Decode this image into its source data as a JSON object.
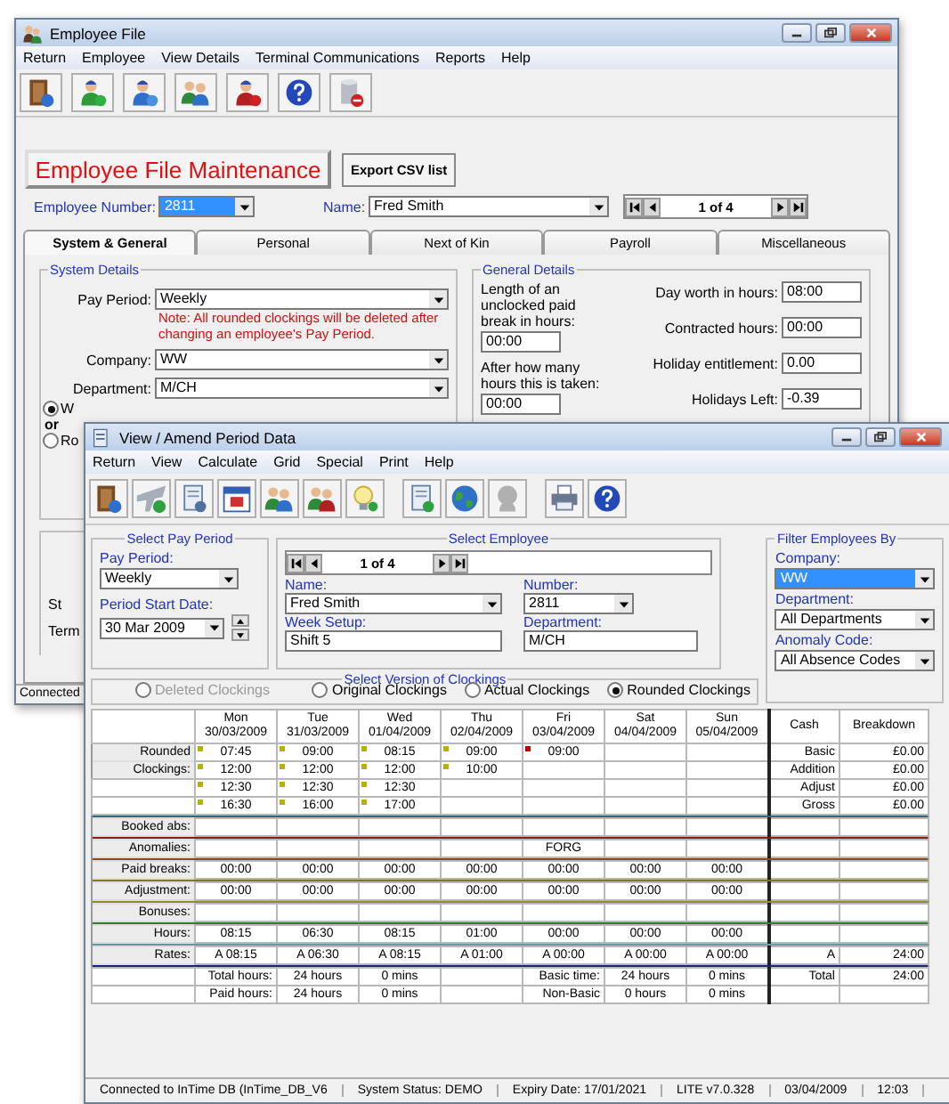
{
  "back_window": {
    "title": "Employee File",
    "menu": [
      "Return",
      "Employee",
      "View Details",
      "Terminal Communications",
      "Reports",
      "Help"
    ],
    "heading_button": "Employee File Maintenance",
    "export_button": "Export CSV list",
    "employee_number": {
      "label": "Employee Number:",
      "value": "2811",
      "highlighted": true
    },
    "name": {
      "label": "Name:",
      "value": "Fred Smith"
    },
    "navigator": "1 of 4",
    "tabs": [
      {
        "label": "System & General",
        "selected": true
      },
      {
        "label": "Personal",
        "selected": false
      },
      {
        "label": "Next of Kin",
        "selected": false
      },
      {
        "label": "Payroll",
        "selected": false
      },
      {
        "label": "Miscellaneous",
        "selected": false
      }
    ],
    "system_details": {
      "title": "System Details",
      "fields": [
        {
          "label": "Pay Period:",
          "value": "Weekly"
        },
        {
          "label": "Company:",
          "value": "WW"
        },
        {
          "label": "Department:",
          "value": "M/CH"
        }
      ],
      "note": "Note: All rounded clockings will be deleted after changing an employee's Pay Period.",
      "radios": [
        {
          "label": "W",
          "selected": true
        },
        {
          "label": "Ro",
          "selected": false
        }
      ],
      "or": "or"
    },
    "general_details": {
      "title": "General Details",
      "break_length": {
        "label": "Length of an unclocked paid break in hours:",
        "value": "00:00"
      },
      "break_after": {
        "label": "After how many hours this is taken:",
        "value": "00:00"
      },
      "fields": [
        {
          "label": "Day worth in hours:",
          "value": "08:00"
        },
        {
          "label": "Contracted hours:",
          "value": "00:00"
        },
        {
          "label": "Holiday entitlement:",
          "value": "0.00"
        },
        {
          "label": "Holidays Left:",
          "value": "-0.39"
        }
      ]
    },
    "cut_labels": [
      "St",
      "Term"
    ],
    "status_bar": "Connected"
  },
  "front_window": {
    "title": "View / Amend Period Data",
    "menu": [
      "Return",
      "View",
      "Calculate",
      "Grid",
      "Special",
      "Print",
      "Help"
    ],
    "pay_period_group": {
      "title": "Select Pay Period",
      "pay_period": {
        "label": "Pay Period:",
        "value": "Weekly"
      },
      "start_date": {
        "label": "Period Start Date:",
        "value": "30 Mar 2009"
      }
    },
    "employee_group": {
      "title": "Select Employee",
      "navigator": "1 of 4",
      "name": {
        "label": "Name:",
        "value": "Fred Smith"
      },
      "number": {
        "label": "Number:",
        "value": "2811"
      },
      "week_setup": {
        "label": "Week Setup:",
        "value": "Shift 5"
      },
      "department": {
        "label": "Department:",
        "value": "M/CH"
      }
    },
    "filter_group": {
      "title": "Filter Employees By",
      "fields": [
        {
          "label": "Company:",
          "value": "WW",
          "highlighted": true
        },
        {
          "label": "Department:",
          "value": "All Departments",
          "highlighted": false
        },
        {
          "label": "Anomaly Code:",
          "value": "All Absence Codes",
          "highlighted": false
        }
      ]
    },
    "version_group": {
      "title": "Select Version of Clockings",
      "options": [
        {
          "label": "Deleted Clockings",
          "selected": false,
          "disabled": true
        },
        {
          "label": "Original Clockings",
          "selected": false,
          "disabled": false
        },
        {
          "label": "Actual Clockings",
          "selected": false,
          "disabled": false
        },
        {
          "label": "Rounded Clockings",
          "selected": true,
          "disabled": false
        }
      ]
    },
    "grid": {
      "columns": [
        {
          "day": "Mon",
          "date": "30/03/2009"
        },
        {
          "day": "Tue",
          "date": "31/03/2009"
        },
        {
          "day": "Wed",
          "date": "01/04/2009"
        },
        {
          "day": "Thu",
          "date": "02/04/2009"
        },
        {
          "day": "Fri",
          "date": "03/04/2009"
        },
        {
          "day": "Sat",
          "date": "04/04/2009"
        },
        {
          "day": "Sun",
          "date": "05/04/2009"
        }
      ],
      "cash_header": "Cash",
      "breakdown_header": "Breakdown",
      "clockings": {
        "color": "#2e6b78",
        "rows": [
          {
            "label": "Rounded",
            "cells": [
              {
                "time": "07:45",
                "color": "#b4b400"
              },
              {
                "time": "09:00",
                "color": "#b4b400"
              },
              {
                "time": "08:15",
                "color": "#b4b400"
              },
              {
                "time": "09:00",
                "color": "#b4b400"
              },
              {
                "time": "09:00",
                "color": "#c00000"
              },
              null,
              null
            ],
            "cash": "Basic",
            "breakdown": "£0.00"
          },
          {
            "label": "Clockings:",
            "cells": [
              {
                "time": "12:00",
                "color": "#b4b400"
              },
              {
                "time": "12:00",
                "color": "#b4b400"
              },
              {
                "time": "12:00",
                "color": "#b4b400"
              },
              {
                "time": "10:00",
                "color": "#b4b400"
              },
              null,
              null,
              null
            ],
            "cash": "Addition",
            "breakdown": "£0.00"
          },
          {
            "cells": [
              {
                "time": "12:30",
                "color": "#b4b400"
              },
              {
                "time": "12:30",
                "color": "#b4b400"
              },
              {
                "time": "12:30",
                "color": "#b4b400"
              },
              null,
              null,
              null,
              null
            ],
            "cash": "Adjust",
            "breakdown": "£0.00"
          },
          {
            "cells": [
              {
                "time": "16:30",
                "color": "#b4b400"
              },
              {
                "time": "16:00",
                "color": "#b4b400"
              },
              {
                "time": "17:00",
                "color": "#b4b400"
              },
              null,
              null,
              null,
              null
            ],
            "cash": "Gross",
            "breakdown": "£0.00"
          }
        ]
      },
      "rows": [
        {
          "label": "Booked abs:",
          "cells": [
            null,
            null,
            null,
            null,
            null,
            null,
            null
          ],
          "color": "#8b1c1c"
        },
        {
          "label": "Anomalies:",
          "cells": [
            null,
            null,
            null,
            null,
            "FORG",
            null,
            null
          ],
          "color": "#8b4a1c"
        },
        {
          "label": "Paid breaks:",
          "cells": [
            "00:00",
            "00:00",
            "00:00",
            "00:00",
            "00:00",
            "00:00",
            "00:00"
          ],
          "color": "#7d7a1c"
        },
        {
          "label": "Adjustment:",
          "cells": [
            "00:00",
            "00:00",
            "00:00",
            "00:00",
            "00:00",
            "00:00",
            "00:00"
          ],
          "color": "#8f8f2a"
        },
        {
          "label": "Bonuses:",
          "cells": [
            null,
            null,
            null,
            null,
            null,
            null,
            null
          ],
          "color": "#2e7d32"
        },
        {
          "label": "Hours:",
          "cells": [
            "08:15",
            "06:30",
            "08:15",
            "01:00",
            "00:00",
            "00:00",
            "00:00"
          ],
          "color": "#5f9ea0"
        },
        {
          "label": "Rates:",
          "cells": [
            "A 08:15",
            "A 06:30",
            "A 08:15",
            "A 01:00",
            "A 00:00",
            "A 00:00",
            "A 00:00"
          ],
          "cash": "A",
          "breakdown": "24:00",
          "color": "#1a237e"
        }
      ],
      "summary_rows": [
        {
          "cells": [
            "Total hours:",
            "24 hours",
            "0 mins",
            null,
            "Basic time:",
            "24 hours",
            "0 mins"
          ],
          "cash": "Total",
          "breakdown": "24:00"
        },
        {
          "cells": [
            "Paid hours:",
            "24 hours",
            "0 mins",
            null,
            "Non-Basic",
            "0 hours",
            "0 mins"
          ]
        }
      ]
    },
    "status_bar": [
      "Connected to InTime DB (InTime_DB_V6",
      "System Status: DEMO",
      "Expiry Date: 17/01/2021",
      "LITE v7.0.328",
      "03/04/2009",
      "12:03"
    ]
  }
}
